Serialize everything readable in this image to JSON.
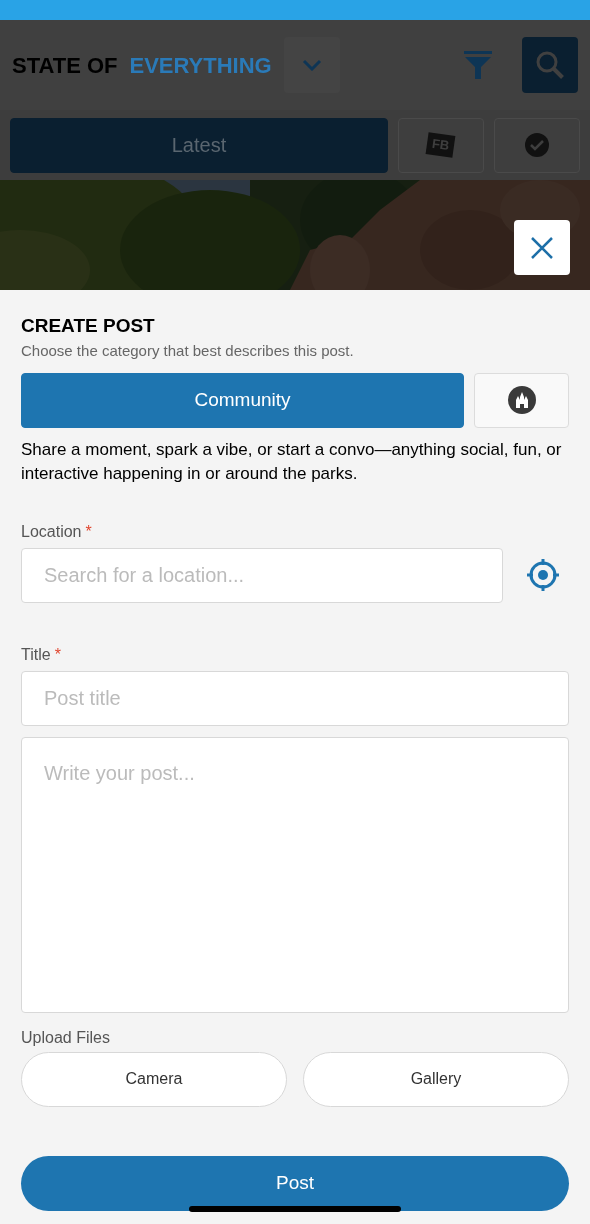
{
  "header": {
    "brand_dark": "STATE OF",
    "brand_accent": "EVERYTHING"
  },
  "tabs": [
    {
      "kind": "text",
      "label": "Latest",
      "selected": true
    },
    {
      "kind": "ticket",
      "label": "FB",
      "selected": false
    },
    {
      "kind": "check",
      "selected": false
    }
  ],
  "sheet": {
    "title": "CREATE POST",
    "subtitle": "Choose the category that best describes this post.",
    "categories": [
      {
        "kind": "text",
        "label": "Community",
        "selected": true
      },
      {
        "kind": "castle",
        "selected": false
      }
    ],
    "description": "Share a moment, spark a vibe, or start a convo—anything social, fun, or interactive happening in or around the parks.",
    "location": {
      "label": "Location",
      "required_mark": "*",
      "placeholder": "Search for a location..."
    },
    "title_field": {
      "label": "Title",
      "required_mark": "*",
      "placeholder": "Post title"
    },
    "body": {
      "placeholder": "Write your post..."
    },
    "upload": {
      "label": "Upload Files",
      "buttons": [
        "Camera",
        "Gallery"
      ]
    },
    "submit": "Post"
  }
}
